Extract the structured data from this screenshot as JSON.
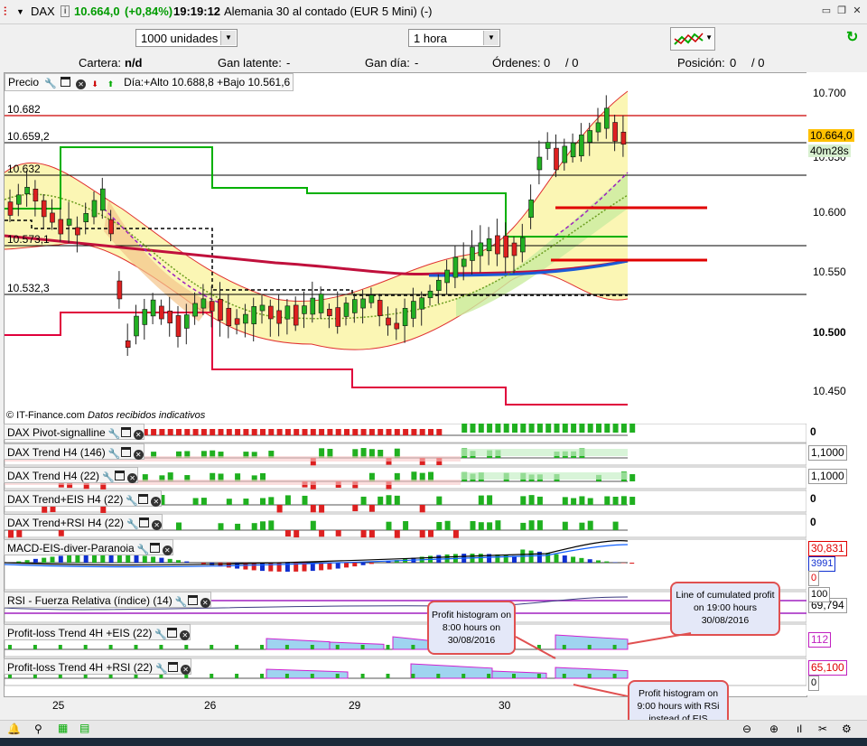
{
  "window": {
    "symbol": "DAX",
    "price": "10.664,0",
    "change": "(+0,84%)",
    "time": "19:19:12",
    "instrument": "Alemania 30 al contado (EUR 5 Mini) (-)",
    "colors": {
      "positive": "#009b00"
    }
  },
  "toolbar": {
    "quantity": "1000 unidades",
    "timeframe": "1 hora"
  },
  "account": {
    "cartera_label": "Cartera:",
    "cartera_value": "n/d",
    "latente_label": "Gan latente:",
    "latente_value": "-",
    "dia_label": "Gan día:",
    "dia_value": "-",
    "ordenes_label": "Órdenes:",
    "ordenes_value": "0",
    "ordenes_value2": "/ 0",
    "posicion_label": "Posición:",
    "posicion_value": "0",
    "posicion_value2": "/ 0"
  },
  "price_panel": {
    "title": "Precio",
    "day_info": "Día:+Alto 10.688,8 +Bajo 10.561,6",
    "copyright": "© IT-Finance.com",
    "disclaimer": "Datos recibidos indicativos",
    "levels": [
      "10.682",
      "10.659,2",
      "10.632",
      "10.573,1",
      "10.532,3"
    ],
    "axis": [
      "10.700",
      "10.650",
      "10.600",
      "10.550",
      "10.500",
      "10.450"
    ],
    "current_price": "10.664,0",
    "countdown": "40m28s"
  },
  "indicators": [
    {
      "name": "DAX Pivot-signalline",
      "value": "0"
    },
    {
      "name": "DAX Trend H4 (146)",
      "value": "1,1000"
    },
    {
      "name": "DAX Trend H4 (22)",
      "value": "1,1000"
    },
    {
      "name": "DAX Trend+EIS H4 (22)",
      "value": "0"
    },
    {
      "name": "DAX Trend+RSI H4 (22)",
      "value": "0"
    },
    {
      "name": "MACD-EIS-diver-Paranoia",
      "value": "30,831",
      "value2": "3991",
      "value3": "0"
    },
    {
      "name": "RSI - Fuerza Relativa (índice) (14)",
      "value": "69,794",
      "value2": "100"
    },
    {
      "name": "Profit-loss Trend 4H +EIS (22)",
      "value": "112"
    },
    {
      "name": "Profit-loss Trend 4H +RSI (22)",
      "value": "65,100",
      "value2": "0"
    }
  ],
  "callouts": {
    "c1": "Line of cumulated profit on 19:00 hours 30/08/2016",
    "c2": "Profit histogram on 8:00 hours on 30/08/2016",
    "c3": "Profit histogram on 9:00 hours with RSi instead of EIS"
  },
  "x_axis": [
    "25",
    "26",
    "29",
    "30"
  ]
}
